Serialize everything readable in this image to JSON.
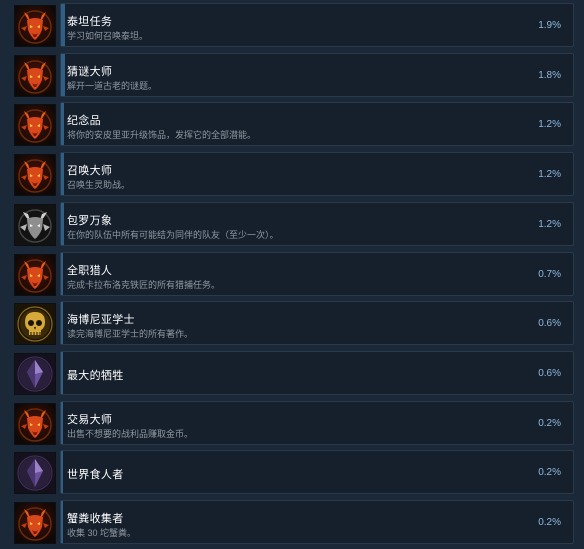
{
  "achievements": [
    {
      "title": "泰坦任务",
      "desc": "学习如何召唤泰坦。",
      "percent": "1.9%",
      "rate": 1.9,
      "icon": "demon-horned-icon"
    },
    {
      "title": "猜谜大师",
      "desc": "解开一道古老的谜题。",
      "percent": "1.8%",
      "rate": 1.8,
      "icon": "demon-horned-icon"
    },
    {
      "title": "纪念品",
      "desc": "将你的安皮里亚升级饰品，发挥它的全部潜能。",
      "percent": "1.2%",
      "rate": 1.2,
      "icon": "demon-horned-icon"
    },
    {
      "title": "召唤大师",
      "desc": "召唤生灵助战。",
      "percent": "1.2%",
      "rate": 1.2,
      "icon": "demon-horned-icon"
    },
    {
      "title": "包罗万象",
      "desc": "在你的队伍中所有可能结为同伴的队友（至少一次）。",
      "percent": "1.2%",
      "rate": 1.2,
      "icon": "grey-demon-icon"
    },
    {
      "title": "全职猎人",
      "desc": "完成卡拉布洛克铁匠的所有猎捕任务。",
      "percent": "0.7%",
      "rate": 0.7,
      "icon": "demon-horned-icon"
    },
    {
      "title": "海博尼亚学士",
      "desc": "读完海博尼亚学士的所有著作。",
      "percent": "0.6%",
      "rate": 0.6,
      "icon": "golden-skull-icon"
    },
    {
      "title": "最大的牺牲",
      "desc": "",
      "percent": "0.6%",
      "rate": 0.6,
      "icon": "purple-crystal-icon"
    },
    {
      "title": "交易大师",
      "desc": "出售不想要的战利品赚取金币。",
      "percent": "0.2%",
      "rate": 0.2,
      "icon": "demon-horned-icon"
    },
    {
      "title": "世界食人者",
      "desc": "",
      "percent": "0.2%",
      "rate": 0.2,
      "icon": "purple-crystal-icon"
    },
    {
      "title": "蟹粪收集者",
      "desc": "收集 30 坨蟹粪。",
      "percent": "0.2%",
      "rate": 0.2,
      "icon": "demon-horned-icon"
    }
  ],
  "colors": {
    "background": "#1b2838",
    "panel": "#16202d",
    "bar": "#2f5f86",
    "percent_text": "#8fb9dd"
  }
}
